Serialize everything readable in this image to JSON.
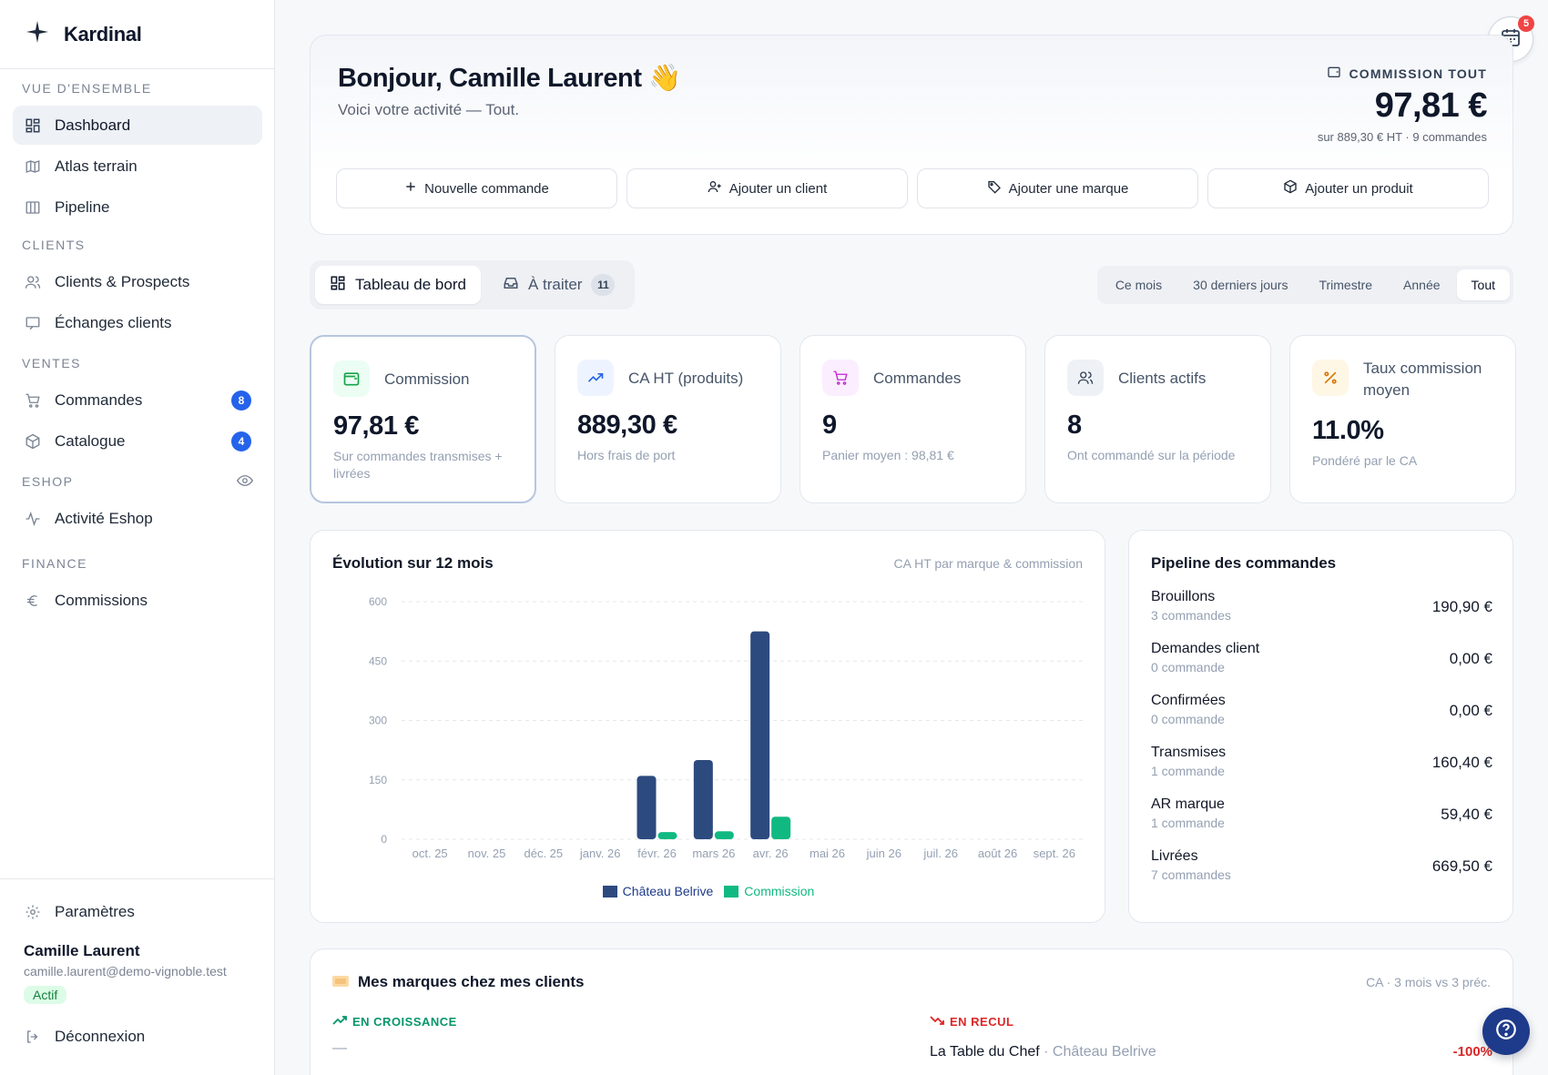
{
  "app": {
    "name": "Kardinal"
  },
  "sidebar": {
    "sections": [
      {
        "title": "VUE D'ENSEMBLE",
        "items": [
          {
            "label": "Dashboard",
            "icon": "grid-icon",
            "active": true
          },
          {
            "label": "Atlas terrain",
            "icon": "map-icon"
          },
          {
            "label": "Pipeline",
            "icon": "columns-icon"
          }
        ]
      },
      {
        "title": "CLIENTS",
        "items": [
          {
            "label": "Clients & Prospects",
            "icon": "users-icon"
          },
          {
            "label": "Échanges clients",
            "icon": "message-icon"
          }
        ]
      },
      {
        "title": "VENTES",
        "items": [
          {
            "label": "Commandes",
            "icon": "cart-icon",
            "badge": "8"
          },
          {
            "label": "Catalogue",
            "icon": "box-icon",
            "badge": "4"
          }
        ]
      },
      {
        "title": "ESHOP",
        "items": [
          {
            "label": "Activité Eshop",
            "icon": "activity-icon"
          }
        ]
      },
      {
        "title": "FINANCE",
        "items": [
          {
            "label": "Commissions",
            "icon": "euro-icon"
          }
        ]
      }
    ],
    "settings_label": "Paramètres",
    "user": {
      "name": "Camille Laurent",
      "email": "camille.laurent@demo-vignoble.test",
      "status": "Actif"
    },
    "logout_label": "Déconnexion"
  },
  "hero": {
    "title": "Bonjour, Camille Laurent 👋",
    "subtitle": "Voici votre activité — Tout.",
    "kpi_label": "COMMISSION TOUT",
    "kpi_value": "97,81 €",
    "kpi_sub": "sur 889,30 € HT · 9 commandes",
    "actions": [
      "Nouvelle commande",
      "Ajouter un client",
      "Ajouter une marque",
      "Ajouter un produit"
    ]
  },
  "calendar_badge": "5",
  "tabs": [
    {
      "label": "Tableau de bord",
      "active": true
    },
    {
      "label": "À traiter",
      "count": "11"
    }
  ],
  "periods": [
    {
      "label": "Ce mois"
    },
    {
      "label": "30 derniers jours"
    },
    {
      "label": "Trimestre"
    },
    {
      "label": "Année"
    },
    {
      "label": "Tout",
      "active": true
    }
  ],
  "kpis": [
    {
      "label": "Commission",
      "value": "97,81 €",
      "sub": "Sur commandes transmises + livrées",
      "icon": "wallet-icon",
      "color": "#16a34a",
      "bg": "#ecfdf3"
    },
    {
      "label": "CA HT (produits)",
      "value": "889,30 €",
      "sub": "Hors frais de port",
      "icon": "trend-up-icon",
      "color": "#2563eb",
      "bg": "#eef4ff"
    },
    {
      "label": "Commandes",
      "value": "9",
      "sub": "Panier moyen : 98,81 €",
      "icon": "cart-icon",
      "color": "#c026d3",
      "bg": "#fbeefe"
    },
    {
      "label": "Clients actifs",
      "value": "8",
      "sub": "Ont commandé sur la période",
      "icon": "users-icon",
      "color": "#334155",
      "bg": "#eef1f6"
    },
    {
      "label": "Taux commission moyen",
      "value": "11.0%",
      "sub": "Pondéré par le CA",
      "icon": "percent-icon",
      "color": "#d97706",
      "bg": "#fff7e6"
    }
  ],
  "chart": {
    "title": "Évolution sur 12 mois",
    "hint": "CA HT par marque & commission"
  },
  "chart_data": {
    "type": "bar",
    "categories": [
      "oct. 25",
      "nov. 25",
      "déc. 25",
      "janv. 26",
      "févr. 26",
      "mars 26",
      "avr. 26",
      "mai 26",
      "juin 26",
      "juil. 26",
      "août 26",
      "sept. 26"
    ],
    "series": [
      {
        "name": "Château Belrive",
        "color": "#2d4a7f",
        "values": [
          0,
          0,
          0,
          0,
          160,
          200,
          525,
          0,
          0,
          0,
          0,
          0
        ]
      },
      {
        "name": "Commission",
        "color": "#10b981",
        "values": [
          0,
          0,
          0,
          0,
          18,
          20,
          57,
          0,
          0,
          0,
          0,
          0
        ]
      }
    ],
    "yticks": [
      0,
      150,
      300,
      450,
      600
    ],
    "ylim": [
      0,
      600
    ],
    "legend": "bottom",
    "grid": true
  },
  "pipeline": {
    "title": "Pipeline des commandes",
    "rows": [
      {
        "name": "Brouillons",
        "count": "3 commandes",
        "amount": "190,90 €"
      },
      {
        "name": "Demandes client",
        "count": "0 commande",
        "amount": "0,00 €"
      },
      {
        "name": "Confirmées",
        "count": "0 commande",
        "amount": "0,00 €"
      },
      {
        "name": "Transmises",
        "count": "1 commande",
        "amount": "160,40 €"
      },
      {
        "name": "AR marque",
        "count": "1 commande",
        "amount": "59,40 €"
      },
      {
        "name": "Livrées",
        "count": "7 commandes",
        "amount": "669,50 €"
      }
    ]
  },
  "brands": {
    "title": "Mes marques chez mes clients",
    "hint": "CA · 3 mois vs 3 préc.",
    "growth_label": "EN CROISSANCE",
    "growth_empty": "—",
    "decline_label": "EN RECUL",
    "decline_rows": [
      {
        "client": "La Table du Chef",
        "brand": "Château Belrive",
        "pct": "-100%"
      }
    ]
  }
}
